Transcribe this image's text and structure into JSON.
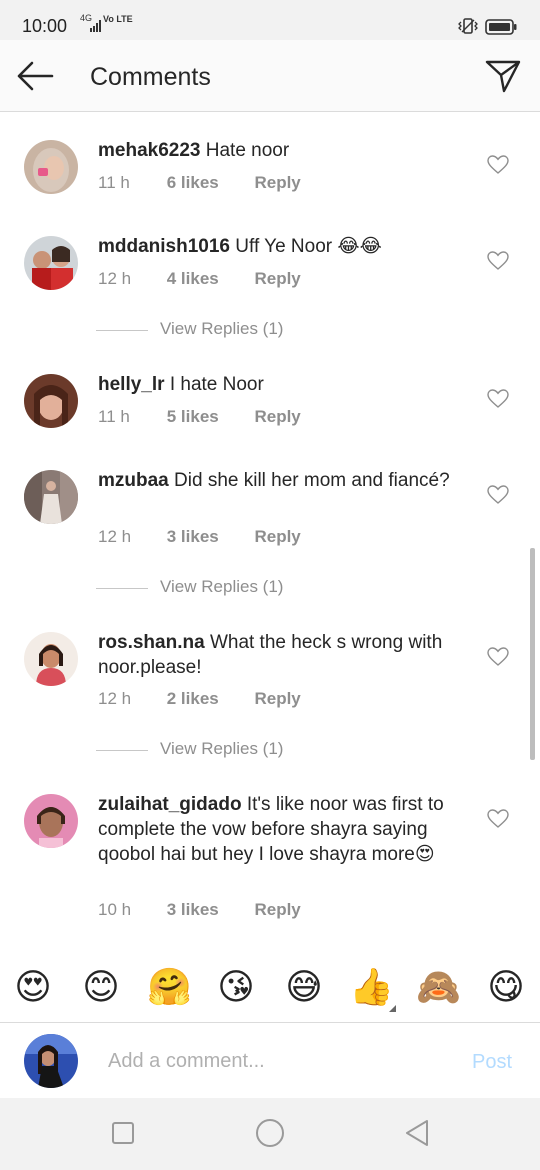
{
  "status_bar": {
    "time": "10:00",
    "network": "4G",
    "volte": "Vo LTE"
  },
  "header": {
    "title": "Comments",
    "back_icon": "arrow-left-icon",
    "send_icon": "paper-plane-icon"
  },
  "comments": [
    {
      "username": "mehak6223",
      "text": "Hate noor",
      "time": "11 h",
      "likes": "6 likes",
      "reply": "Reply",
      "avatar_color": "#b9a08c"
    },
    {
      "username": "mddanish1016",
      "text": "Uff Ye Noor 😂😂",
      "time": "12 h",
      "likes": "4 likes",
      "reply": "Reply",
      "view_replies": "View Replies (1)",
      "avatar_color": "#c0392b"
    },
    {
      "username": "helly_lr",
      "text": "I hate Noor",
      "time": "11 h",
      "likes": "5 likes",
      "reply": "Reply",
      "avatar_color": "#8d5a3c"
    },
    {
      "username": "mzubaa",
      "text": "Did she kill her mom and fiancé?",
      "time": "12 h",
      "likes": "3 likes",
      "reply": "Reply",
      "view_replies": "View Replies (1)",
      "avatar_color": "#7a6a66"
    },
    {
      "username": "ros.shan.na",
      "text": "What the heck s wrong with noor.please!",
      "time": "12 h",
      "likes": "2 likes",
      "reply": "Reply",
      "view_replies": "View Replies (1)",
      "avatar_color": "#d9a088"
    },
    {
      "username": "zulaihat_gidado",
      "text": "It's like noor was first to complete the vow before shayra saying qoobol hai but hey I love shayra more😍",
      "time": "10 h",
      "likes": "3 likes",
      "reply": "Reply",
      "avatar_color": "#e08bb0"
    }
  ],
  "emoji_bar": [
    "😍",
    "😊",
    "🤗",
    "😘",
    "😅",
    "👍",
    "🙈",
    "😋"
  ],
  "composer": {
    "placeholder": "Add a comment...",
    "post_label": "Post",
    "post_color": "#b3dbff"
  },
  "colors": {
    "text": "#262626",
    "secondary": "#8e8e8e",
    "divider": "#dbdbdb"
  }
}
